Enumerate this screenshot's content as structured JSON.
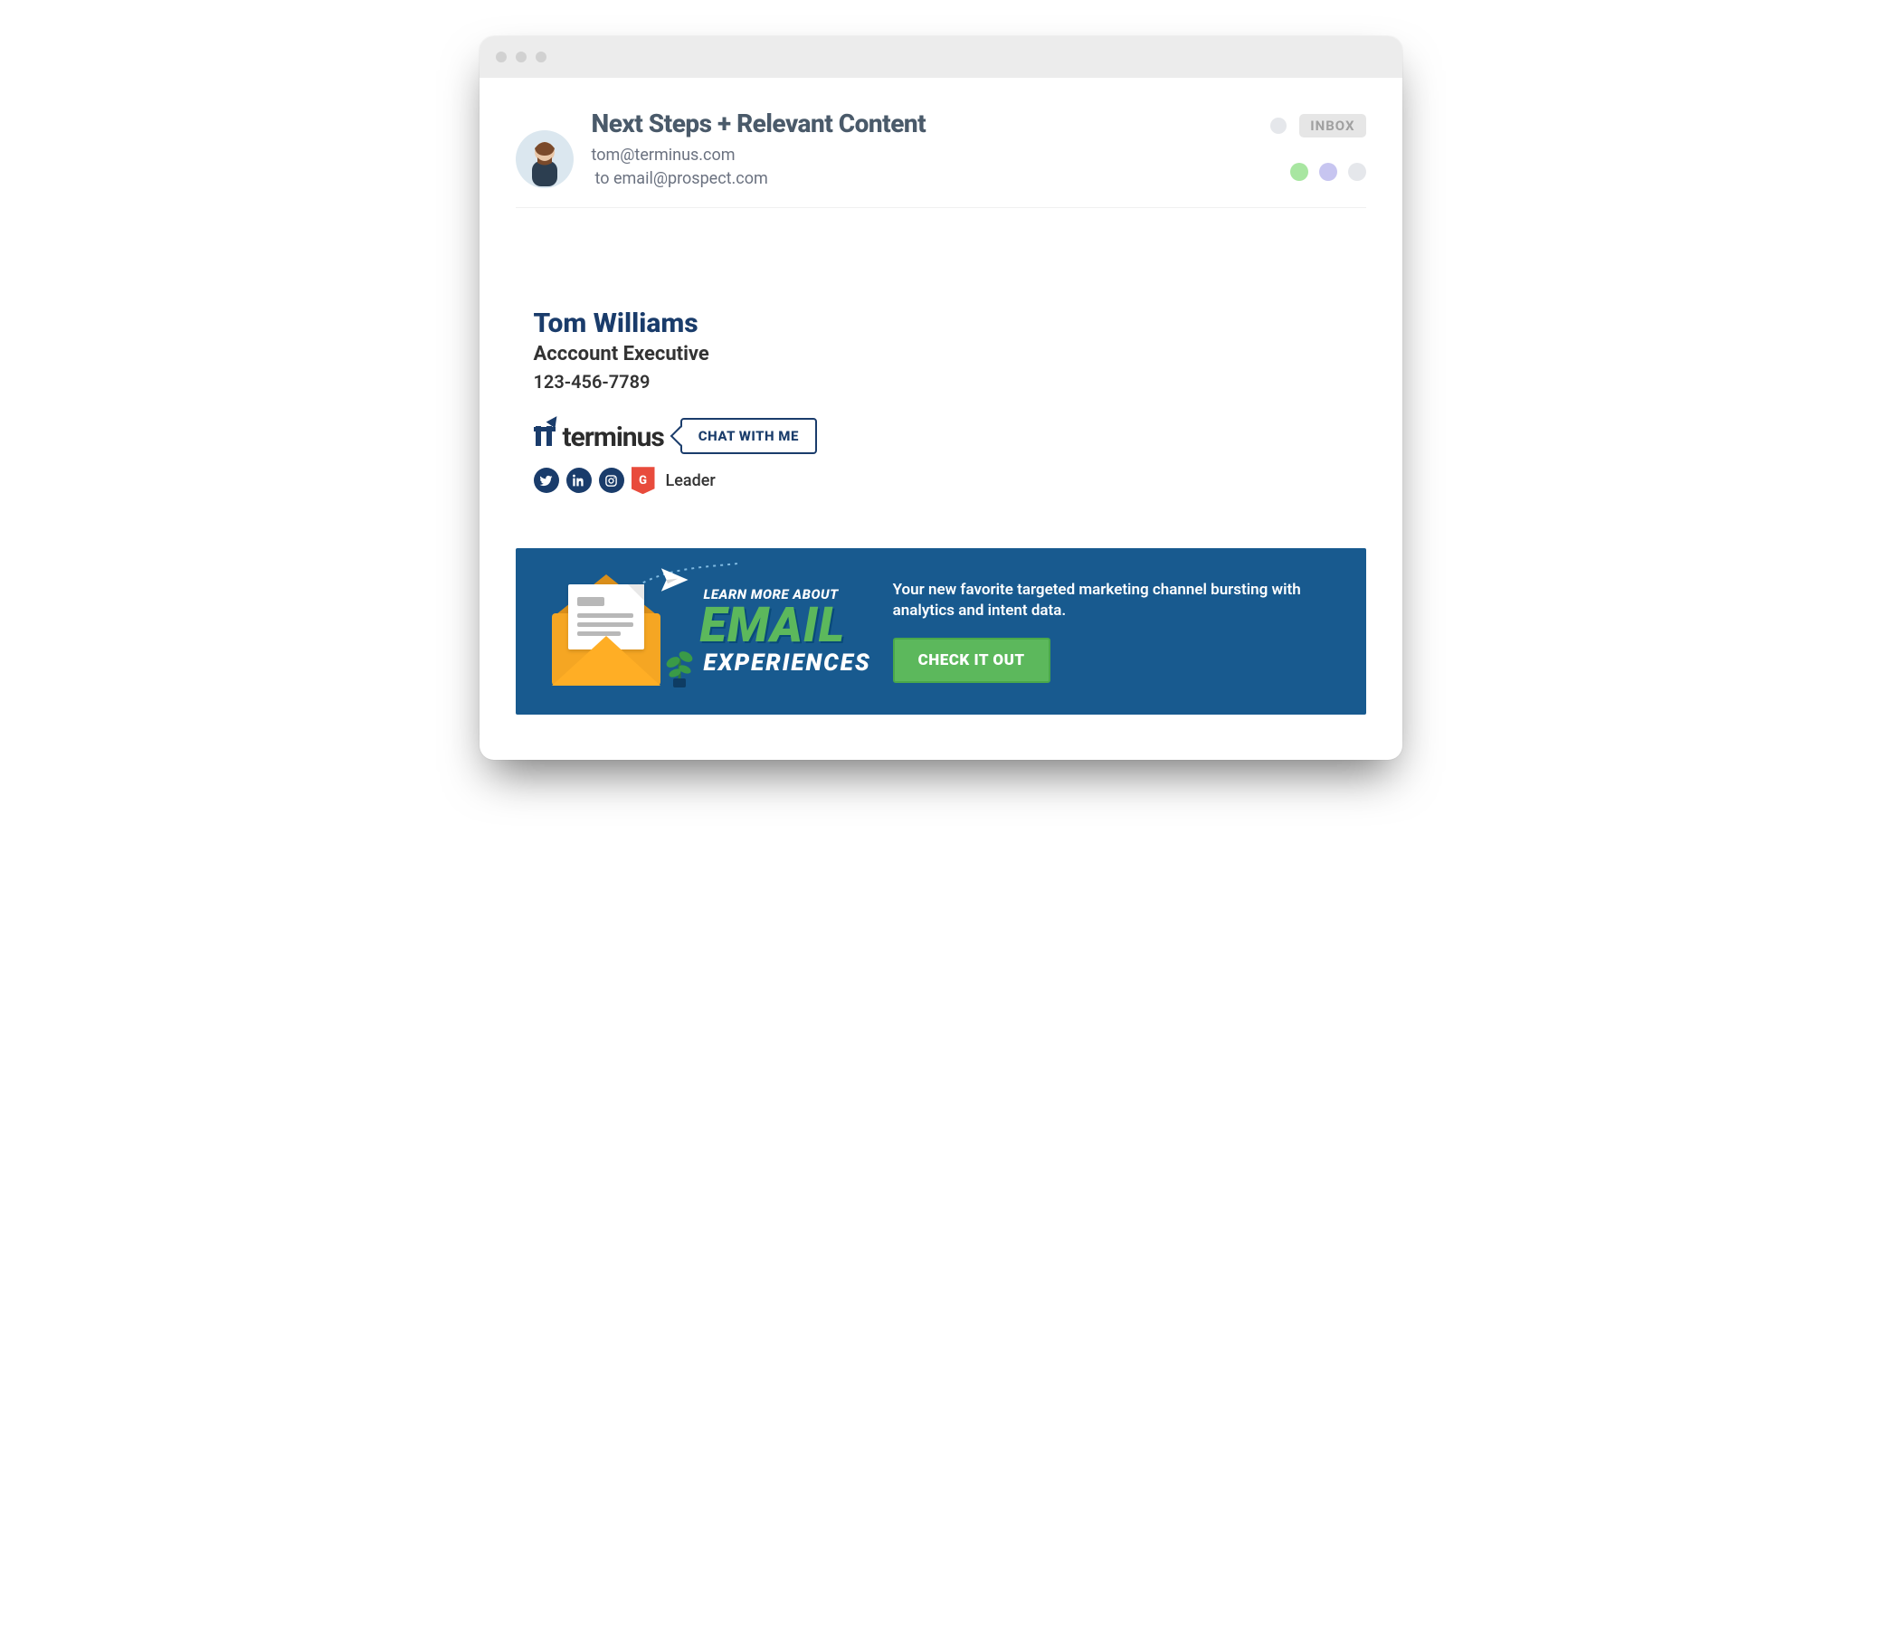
{
  "window": {
    "inbox_badge": "INBOX"
  },
  "email": {
    "subject": "Next Steps + Relevant Content",
    "from": "tom@terminus.com",
    "to_prefix": "to ",
    "to": "email@prospect.com"
  },
  "signature": {
    "name": "Tom Williams",
    "title": "Acccount Executive",
    "phone": "123-456-7789",
    "brand": "terminus",
    "chat_button": "CHAT WITH ME",
    "g2_label": "Leader",
    "social": {
      "twitter": "twitter",
      "linkedin": "linkedin",
      "instagram": "instagram",
      "g2": "G"
    }
  },
  "banner": {
    "eyebrow": "LEARN MORE ABOUT",
    "headline": "EMAIL",
    "subhead": "EXPERIENCES",
    "description": "Your new favorite targeted marketing channel bursting with analytics and intent data.",
    "cta": "CHECK IT OUT"
  }
}
